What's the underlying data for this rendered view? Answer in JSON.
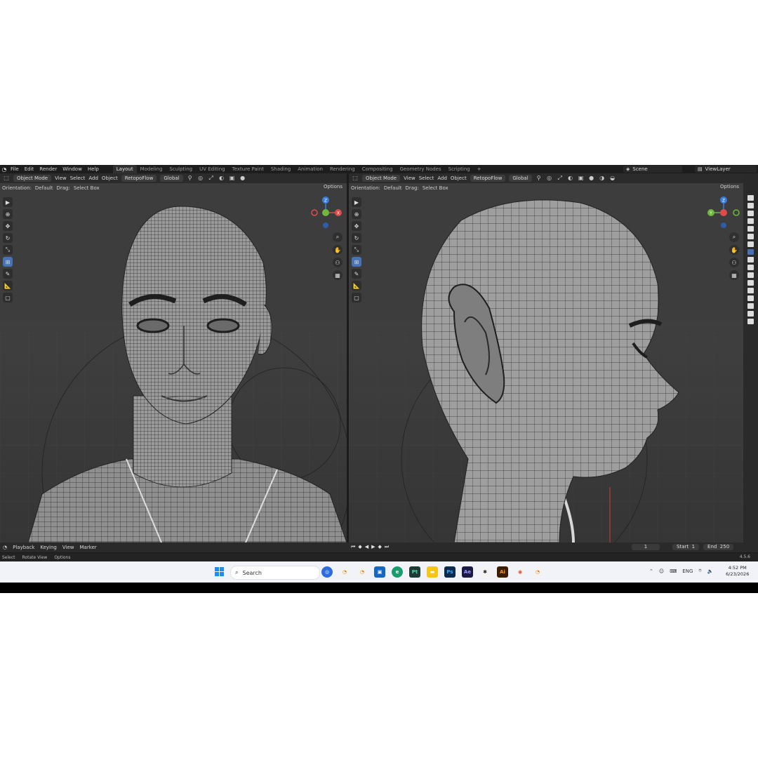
{
  "menubar": {
    "items": [
      "File",
      "Edit",
      "Render",
      "Window",
      "Help"
    ],
    "workspaces": [
      "Layout",
      "Modeling",
      "Sculpting",
      "UV Editing",
      "Texture Paint",
      "Shading",
      "Animation",
      "Rendering",
      "Compositing",
      "Geometry Nodes",
      "Scripting"
    ],
    "active_workspace": "Layout",
    "scene": "Scene",
    "view_layer": "ViewLayer"
  },
  "viewport_header": {
    "mode": "Object Mode",
    "menus": [
      "View",
      "Select",
      "Add",
      "Object"
    ],
    "addon": "RetopoFlow",
    "transform": "Global",
    "orientation_label": "Orientation:",
    "orientation_value": "Default",
    "drag_label": "Drag:",
    "drag_value": "Select Box",
    "options": "Options"
  },
  "gizmo": {
    "x": "X",
    "y": "Y",
    "z": "Z"
  },
  "timeline": {
    "menus": [
      "Playback",
      "Keying",
      "View",
      "Marker"
    ],
    "current_frame": "1",
    "start_label": "Start",
    "start_value": "1",
    "end_label": "End",
    "end_value": "250"
  },
  "statusbar": {
    "items": [
      "Select",
      "Rotate View",
      "Options"
    ],
    "version": "4.5.6"
  },
  "taskbar": {
    "search_placeholder": "Search",
    "apps": [
      {
        "name": "Pt",
        "color": "#1e3a34"
      },
      {
        "name": "Ps",
        "color": "#0c2a4d"
      },
      {
        "name": "Ae",
        "color": "#1a1947"
      },
      {
        "name": "Ai",
        "color": "#3b1d02"
      }
    ],
    "language": "ENG",
    "time": "4:52 PM",
    "date": "6/23/2026"
  },
  "colors": {
    "accent": "#4772b3",
    "viewport_bg": "#3d3d3d",
    "axis_x": "#e04a4a",
    "axis_y": "#6fb83a",
    "axis_z": "#3b7ee0"
  }
}
